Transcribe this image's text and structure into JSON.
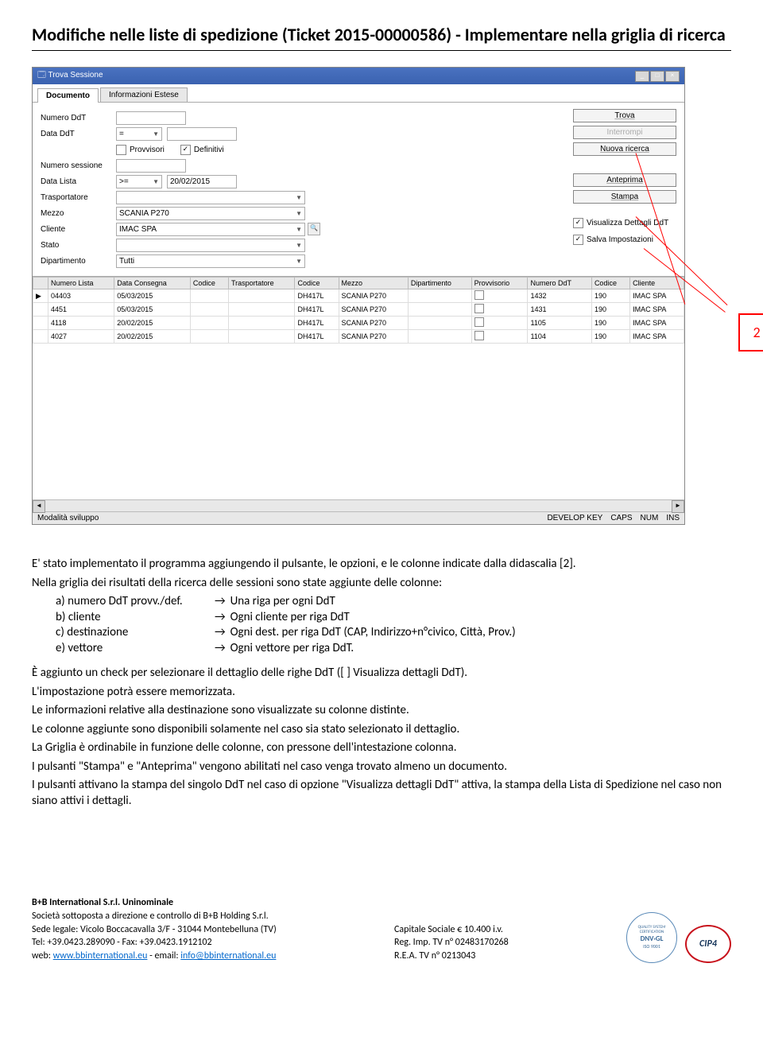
{
  "doc": {
    "title": "Modifiche nelle liste di spedizione (Ticket 2015-00000586) - Implementare nella griglia di ricerca"
  },
  "window": {
    "title": "Trova Sessione",
    "tabs": {
      "active": "Documento",
      "inactive": "Informazioni Estese"
    },
    "form": {
      "numero_ddt": {
        "label": "Numero DdT",
        "value": ""
      },
      "data_ddt": {
        "label": "Data DdT",
        "op": "=",
        "value": ""
      },
      "provvisori": {
        "label": "Provvisori"
      },
      "definitivi": {
        "label": "Definitivi"
      },
      "numero_sessione": {
        "label": "Numero sessione",
        "value": ""
      },
      "data_lista": {
        "label": "Data Lista",
        "op": ">=",
        "value": "20/02/2015"
      },
      "trasportatore": {
        "label": "Trasportatore",
        "value": ""
      },
      "mezzo": {
        "label": "Mezzo",
        "value": "SCANIA P270"
      },
      "cliente": {
        "label": "Cliente",
        "value": "IMAC SPA"
      },
      "stato": {
        "label": "Stato",
        "value": ""
      },
      "dipartimento": {
        "label": "Dipartimento",
        "value": "Tutti"
      }
    },
    "buttons": {
      "trova": "Trova",
      "interrompi": "Interrompi",
      "nuova_ricerca": "Nuova ricerca",
      "anteprima": "Anteprima",
      "stampa": "Stampa"
    },
    "checks": {
      "visualizza_dettagli": "Visualizza Dettagli DdT",
      "salva_impostazioni": "Salva Impostazioni"
    },
    "grid": {
      "headers": [
        "",
        "Numero Lista",
        "Data Consegna",
        "Codice",
        "Trasportatore",
        "Codice",
        "Mezzo",
        "Dipartimento",
        "Provvisorio",
        "Numero DdT",
        "Codice",
        "Cliente"
      ],
      "rows": [
        [
          "▶",
          "04403",
          "05/03/2015",
          "",
          "",
          "DH417L",
          "SCANIA P270",
          "",
          "",
          "1432",
          "190",
          "IMAC SPA"
        ],
        [
          "",
          "4451",
          "05/03/2015",
          "",
          "",
          "DH417L",
          "SCANIA P270",
          "",
          "",
          "1431",
          "190",
          "IMAC SPA"
        ],
        [
          "",
          "4118",
          "20/02/2015",
          "",
          "",
          "DH417L",
          "SCANIA P270",
          "",
          "",
          "1105",
          "190",
          "IMAC SPA"
        ],
        [
          "",
          "4027",
          "20/02/2015",
          "",
          "",
          "DH417L",
          "SCANIA P270",
          "",
          "",
          "1104",
          "190",
          "IMAC SPA"
        ]
      ]
    },
    "statusbar": {
      "left": "Modalità sviluppo",
      "right": [
        "DEVELOP KEY",
        "CAPS",
        "NUM",
        "INS"
      ]
    }
  },
  "callout": {
    "number": "2"
  },
  "body": {
    "p1": "E' stato implementato il programma aggiungendo il pulsante, le opzioni, e le colonne indicate dalla didascalia [2].",
    "p2": "Nella griglia dei risultati della ricerca delle sessioni sono state aggiunte delle colonne:",
    "defs": [
      {
        "k": "a) numero DdT provv./def.",
        "v": "Una riga per ogni DdT"
      },
      {
        "k": "b) cliente",
        "v": "Ogni cliente per riga DdT"
      },
      {
        "k": "c) destinazione",
        "v": "Ogni dest. per riga DdT (CAP, Indirizzo+n°civico, Città, Prov.)"
      },
      {
        "k": "e) vettore",
        "v": "Ogni vettore per riga DdT."
      }
    ],
    "p3": "È aggiunto un check per selezionare il dettaglio delle righe DdT ([ ] Visualizza dettagli DdT).",
    "p4": "L'impostazione potrà essere memorizzata.",
    "p5": "Le informazioni relative alla destinazione sono visualizzate su colonne distinte.",
    "p6": "Le colonne aggiunte sono disponibili solamente nel caso sia stato selezionato il dettaglio.",
    "p7": "La Griglia è ordinabile in funzione delle colonne, con pressone dell'intestazione colonna.",
    "p8": "I pulsanti \"Stampa\" e \"Anteprima\" vengono abilitati nel caso venga trovato almeno un documento.",
    "p9": "I pulsanti attivano la stampa del singolo DdT nel caso di opzione \"Visualizza dettagli DdT\" attiva, la stampa della Lista di Spedizione nel caso non siano attivi i dettagli."
  },
  "footer": {
    "company_bold": "B+B International S.r.l. Uninominale",
    "line2": "Società sottoposta a direzione e controllo di B+B Holding S.r.l.",
    "line3_label": "Sede legale: ",
    "line3": "Vicolo Boccacavalla 3/F - 31044 Montebelluna (TV)",
    "tel": "Tel: +39.0423.289090 - Fax: +39.0423.1912102",
    "web_label": "web: ",
    "web": "www.bbinternational.eu",
    "email_label": " - email: ",
    "email": "info@bbinternational.eu",
    "cap": "Capitale Sociale € 10.400 i.v.",
    "reg": "Reg. Imp. TV n° 02483170268",
    "rea": "R.E.A. TV n° 0213043",
    "cert": {
      "line1": "QUALITY SYSTEM CERTIFICATION",
      "line2": "DNV·GL",
      "line3": "ISO 9001"
    },
    "cip": "CIP4"
  }
}
